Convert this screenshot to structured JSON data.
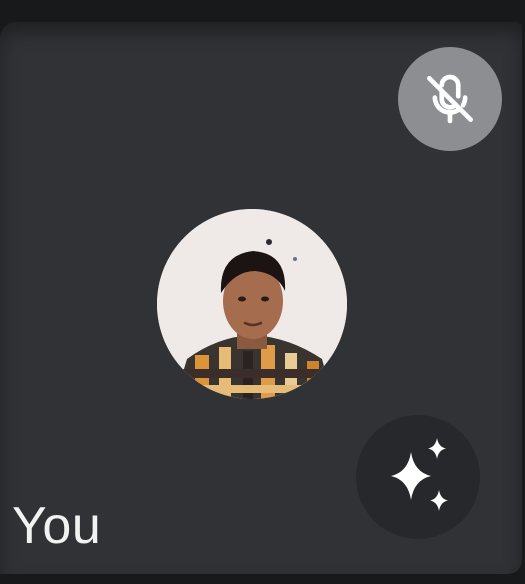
{
  "participant": {
    "name": "You"
  },
  "icons": {
    "mute": "microphone-off-icon",
    "effects": "sparkle-effects-icon",
    "avatar": "profile-photo"
  },
  "colors": {
    "tile_background": "#313236",
    "mute_badge": "#8d8e92",
    "effects_button": "#27282b",
    "label_text": "#f2f2f2"
  }
}
